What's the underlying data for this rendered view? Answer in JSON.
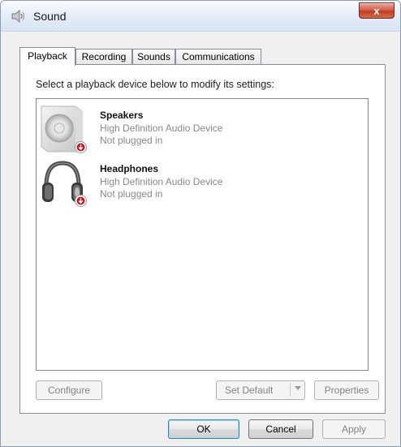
{
  "window": {
    "title": "Sound",
    "close_symbol": "x",
    "icons": {
      "title": "speaker-icon",
      "close": "close-icon"
    }
  },
  "tabs": [
    {
      "label": "Playback",
      "active": true
    },
    {
      "label": "Recording",
      "active": false
    },
    {
      "label": "Sounds",
      "active": false
    },
    {
      "label": "Communications",
      "active": false
    }
  ],
  "playback": {
    "instruction": "Select a playback device below to modify its settings:",
    "devices": [
      {
        "name": "Speakers",
        "description": "High Definition Audio Device",
        "status": "Not plugged in",
        "icon": "speakers-icon",
        "status_icon": "unplugged-icon"
      },
      {
        "name": "Headphones",
        "description": "High Definition Audio Device",
        "status": "Not plugged in",
        "icon": "headphones-icon",
        "status_icon": "unplugged-icon"
      }
    ],
    "buttons": {
      "configure": "Configure",
      "set_default": "Set Default",
      "properties": "Properties"
    }
  },
  "footer": {
    "ok": "OK",
    "cancel": "Cancel",
    "apply": "Apply"
  },
  "colors": {
    "title_gradient_top": "#f9fbfe",
    "close_button": "#c13c23",
    "badge_red": "#c8161c",
    "disabled_text": "#838383",
    "secondary_text": "#8a8a8a",
    "default_button_border": "#3c7fb1"
  }
}
